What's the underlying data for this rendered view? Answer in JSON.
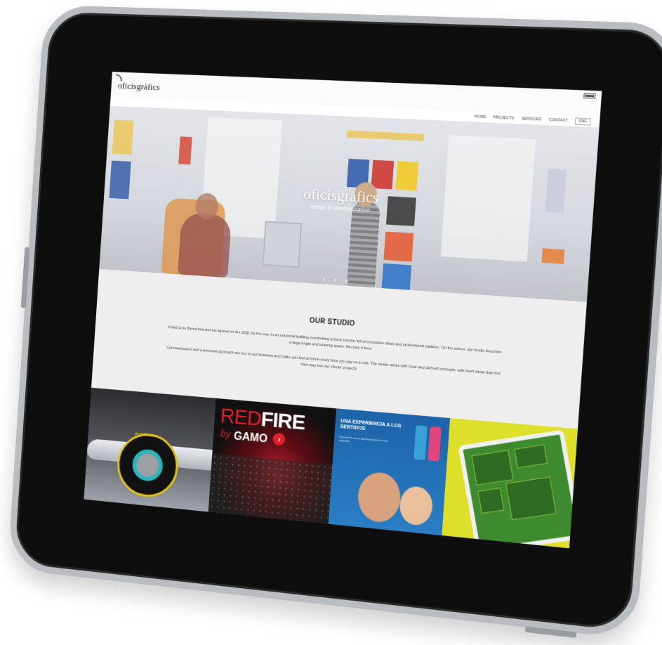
{
  "site": {
    "logo": "oficisgràfics"
  },
  "nav": {
    "items": [
      "HOME",
      "PROJECTS",
      "SERVICES",
      "CONTACT"
    ],
    "language": "ENG"
  },
  "hero": {
    "title": "oficisgràfics",
    "subtitle": "design & communication",
    "social_icons": [
      "twitter-icon",
      "facebook-icon",
      "linkedin-icon"
    ]
  },
  "studio": {
    "heading": "OUR STUDIO",
    "paragraph1": "It had to be Barcelona and we agreed on the 22@, by the sea. In an industrial building overlooking a lively interior, full of innovative ideas and professional tradition. On the corner, our studio becomes a large bright and relaxing space. We love it here.",
    "paragraph2": "Communication and a personal approach are key to our business and make you feel at home every time you pay us a visit. The studio works with clear and defined concepts, with fresh ideas that find their way into our clients' projects."
  },
  "portfolio": {
    "pirelli_label": "PIRELLI",
    "redfire_red": "RED",
    "redfire_fire": "FIRE",
    "redfire_by": "by",
    "redfire_brand": "GAMO",
    "kids_headline": "UNA EXPERIENCIA A LOS SENTIDOS",
    "kids_small": "Descubre la nueva experiencia para los más pequeños"
  },
  "colors": {
    "bezel": "#0e0e0e",
    "frame": "#b9bcc0",
    "accent_red": "#e01f2b",
    "accent_yellow": "#dddf2a"
  }
}
